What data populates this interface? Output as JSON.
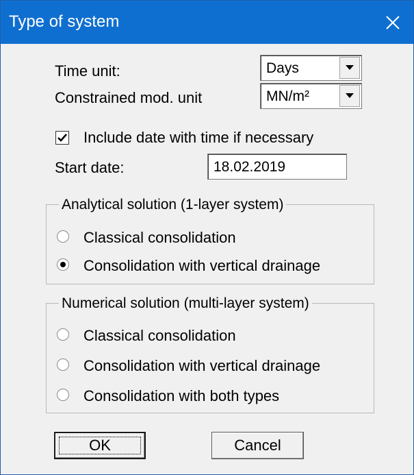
{
  "window": {
    "title": "Type of system"
  },
  "settings": {
    "time_unit_label": "Time unit:",
    "time_unit_value": "Days",
    "modulus_unit_label": "Constrained mod. unit",
    "modulus_unit_value": "MN/m²",
    "include_date_label": "Include date with time if necessary",
    "include_date_checked": true,
    "start_date_label": "Start date:",
    "start_date_value": "18.02.2019"
  },
  "analytical": {
    "legend": "Analytical solution (1-layer system)",
    "options": [
      {
        "label": "Classical consolidation",
        "selected": false
      },
      {
        "label": "Consolidation with vertical drainage",
        "selected": true
      }
    ]
  },
  "numerical": {
    "legend": "Numerical solution (multi-layer system)",
    "options": [
      {
        "label": "Classical consolidation",
        "selected": false
      },
      {
        "label": "Consolidation with vertical drainage",
        "selected": false
      },
      {
        "label": "Consolidation with both types",
        "selected": false
      }
    ]
  },
  "buttons": {
    "ok_label": "OK",
    "cancel_label": "Cancel"
  },
  "colors": {
    "titlebar": "#0f6fd0",
    "dialog_bg": "#f0f0f0"
  }
}
